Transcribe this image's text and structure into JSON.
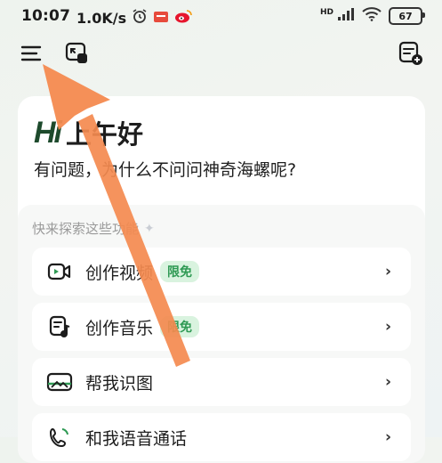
{
  "status_bar": {
    "time": "10:07",
    "speed": "1.0K/s",
    "signal_label": "HD",
    "battery": "67"
  },
  "greeting": {
    "logo": "Hi",
    "text": "上午好",
    "subtitle": "有问题，为什么不问问神奇海螺呢?"
  },
  "features": {
    "title": "快来探索这些功能",
    "items": [
      {
        "label": "创作视频",
        "badge": "限免",
        "icon": "video-icon"
      },
      {
        "label": "创作音乐",
        "badge": "限免",
        "icon": "music-note-icon"
      },
      {
        "label": "帮我识图",
        "badge": "",
        "icon": "image-icon"
      },
      {
        "label": "和我语音通话",
        "badge": "",
        "icon": "voice-call-icon"
      }
    ]
  },
  "colors": {
    "accent_orange": "#f48a4f",
    "badge_green": "#2f9a54",
    "logo_green": "#1d4a2c"
  }
}
